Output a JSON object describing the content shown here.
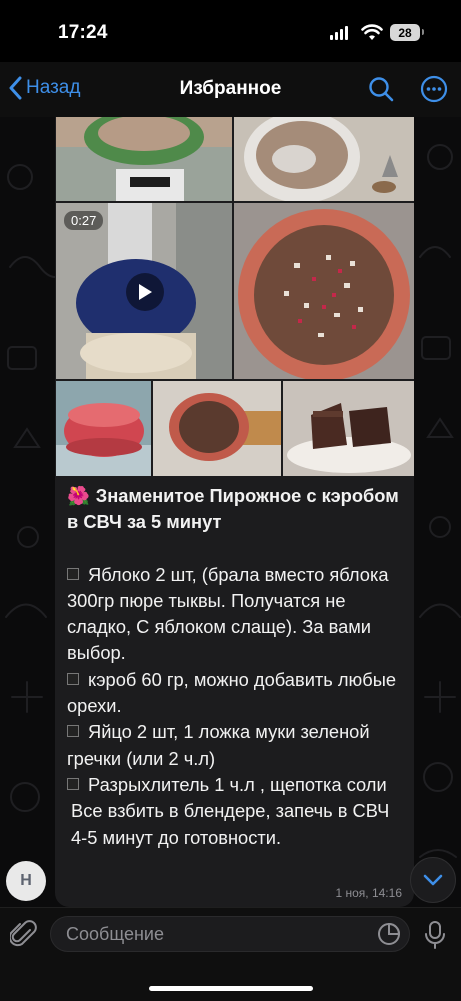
{
  "status_bar": {
    "time": "17:24",
    "battery": "28"
  },
  "nav": {
    "back_label": "Назад",
    "title": "Избранное"
  },
  "media": {
    "video_duration": "0:27"
  },
  "message": {
    "title": "Знаменитое Пирожное с кэробом в СВЧ за 5 минут",
    "title_emoji": "🌺",
    "lines": [
      "Яблоко 2 шт, (брала вместо яблока 300гр пюре тыквы. Получатся не сладко, С яблоком слаще). За вами выбор.",
      "кэроб 60 гр, можно добавить любые орехи.",
      "Яйцо 2 шт, 1 ложка муки зеленой гречки (или 2 ч.л)",
      "Разрыхлитель 1 ч.л , щепотка соли",
      "Все взбить в блендере, запечь в СВЧ 4-5 минут до готовности."
    ],
    "time": "1 ноя, 14:16"
  },
  "avatar_initial": "Н",
  "input": {
    "placeholder": "Сообщение"
  },
  "colors": {
    "accent": "#3e8fe8",
    "bubble": "#1c1c1e",
    "background": "#000000"
  },
  "icons": [
    "back-chevron-icon",
    "search-icon",
    "more-icon",
    "play-icon",
    "chevron-down-icon",
    "paperclip-icon",
    "sticker-icon",
    "microphone-icon"
  ]
}
